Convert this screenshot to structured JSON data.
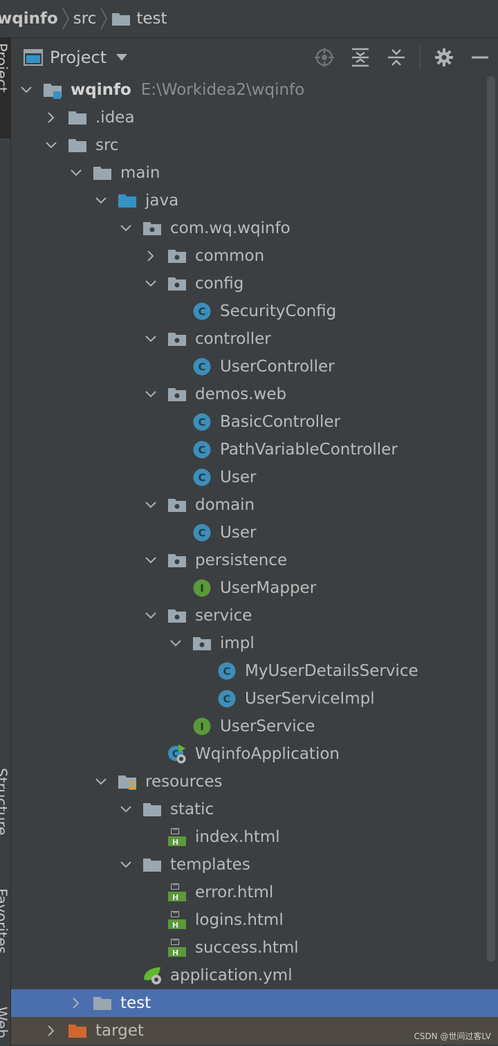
{
  "breadcrumb": {
    "items": [
      "wqinfo",
      "src",
      "test"
    ]
  },
  "left_strip": {
    "project_label": "Project",
    "structure_label": "Structure",
    "favorites_label": "Favorites",
    "web_label": "Web"
  },
  "panel": {
    "title": "Project",
    "buttons": [
      "locate-icon",
      "expand-all-icon",
      "collapse-all-icon",
      "gear-icon",
      "minimize-icon"
    ]
  },
  "tree": {
    "root": {
      "name": "wqinfo",
      "path": "E:\\Workidea2\\wqinfo"
    },
    "nodes": [
      {
        "label": "wqinfo",
        "icon": "module-folder-icon"
      },
      {
        "label": ".idea",
        "icon": "folder-icon"
      },
      {
        "label": "src",
        "icon": "folder-icon"
      },
      {
        "label": "main",
        "icon": "folder-icon"
      },
      {
        "label": "java",
        "icon": "source-folder-icon"
      },
      {
        "label": "com.wq.wqinfo",
        "icon": "package-icon"
      },
      {
        "label": "common",
        "icon": "package-icon"
      },
      {
        "label": "config",
        "icon": "package-icon"
      },
      {
        "label": "SecurityConfig",
        "icon": "class-icon"
      },
      {
        "label": "controller",
        "icon": "package-icon"
      },
      {
        "label": "UserController",
        "icon": "class-icon"
      },
      {
        "label": "demos.web",
        "icon": "package-icon"
      },
      {
        "label": "BasicController",
        "icon": "class-icon"
      },
      {
        "label": "PathVariableController",
        "icon": "class-icon"
      },
      {
        "label": "User",
        "icon": "class-icon"
      },
      {
        "label": "domain",
        "icon": "package-icon"
      },
      {
        "label": "User",
        "icon": "class-icon"
      },
      {
        "label": "persistence",
        "icon": "package-icon"
      },
      {
        "label": "UserMapper",
        "icon": "interface-icon"
      },
      {
        "label": "service",
        "icon": "package-icon"
      },
      {
        "label": "impl",
        "icon": "package-icon"
      },
      {
        "label": "MyUserDetailsService",
        "icon": "class-icon"
      },
      {
        "label": "UserServiceImpl",
        "icon": "class-icon"
      },
      {
        "label": "UserService",
        "icon": "interface-icon"
      },
      {
        "label": "WqinfoApplication",
        "icon": "spring-boot-app-icon"
      },
      {
        "label": "resources",
        "icon": "resources-folder-icon"
      },
      {
        "label": "static",
        "icon": "folder-icon"
      },
      {
        "label": "index.html",
        "icon": "html-file-icon"
      },
      {
        "label": "templates",
        "icon": "folder-icon"
      },
      {
        "label": "error.html",
        "icon": "html-file-icon"
      },
      {
        "label": "logins.html",
        "icon": "html-file-icon"
      },
      {
        "label": "success.html",
        "icon": "html-file-icon"
      },
      {
        "label": "application.yml",
        "icon": "spring-config-icon"
      },
      {
        "label": "test",
        "icon": "folder-icon"
      },
      {
        "label": "target",
        "icon": "excluded-folder-icon"
      }
    ]
  },
  "watermark": "CSDN @世间过客LV"
}
